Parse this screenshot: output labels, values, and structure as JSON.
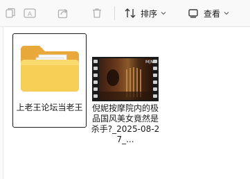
{
  "toolbar": {
    "sort_label": "排序",
    "view_label": "查看"
  },
  "files": [
    {
      "name": "上老王论坛当老王",
      "type": "folder",
      "selected": true
    },
    {
      "name": "倪妮按摩院内的极品国风美女竟然是杀手?_2025-08-27_...",
      "type": "video",
      "selected": false,
      "video_badge": "M|N"
    }
  ],
  "colors": {
    "folder_back": "#e8a93a",
    "folder_front": "#f7cf57",
    "selection_border": "#1f1f1f"
  }
}
